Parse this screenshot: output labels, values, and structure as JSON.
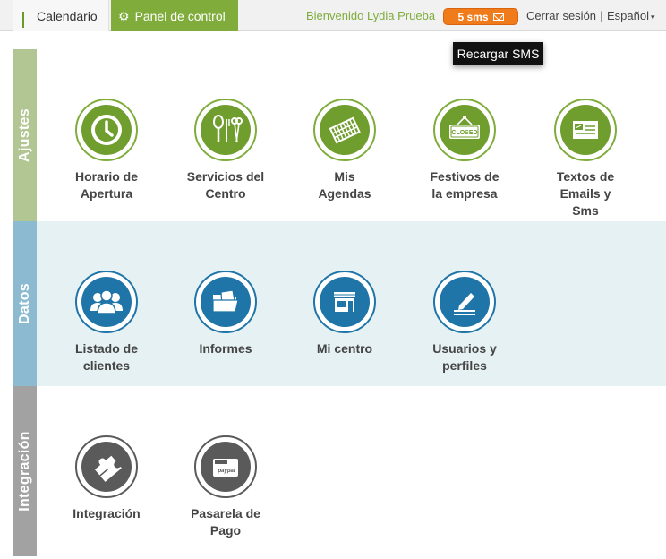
{
  "topbar": {
    "tab_calendar": "Calendario",
    "tab_panel": "Panel de control",
    "welcome": "Bienvenido Lydia Prueba",
    "sms_badge": "5 sms",
    "logout": "Cerrar sesión",
    "separator": "|",
    "language": "Español",
    "language_caret": "▾"
  },
  "tooltip": "Recargar SMS",
  "colors": {
    "accent_green": "#7fac3b",
    "sms_orange": "#f07b1a",
    "datos_blue": "#1f74a8",
    "integration_gray": "#5a5a5a"
  },
  "sections": {
    "ajustes": {
      "label": "Ajustes",
      "items": [
        {
          "line1": "Horario de",
          "line2": "Apertura",
          "line3": "",
          "icon": "clock-icon"
        },
        {
          "line1": "Servicios del",
          "line2": "Centro",
          "line3": "",
          "icon": "tools-icon"
        },
        {
          "line1": "Mis",
          "line2": "Agendas",
          "line3": "",
          "icon": "agenda-icon"
        },
        {
          "line1": "Festivos de",
          "line2": "la empresa",
          "line3": "",
          "icon": "closed-sign-icon",
          "sign_text": "CLOSED"
        },
        {
          "line1": "Textos de",
          "line2": "Emails y",
          "line3": "Sms",
          "icon": "mail-icon"
        }
      ]
    },
    "datos": {
      "label": "Datos",
      "items": [
        {
          "line1": "Listado de",
          "line2": "clientes",
          "icon": "people-icon"
        },
        {
          "line1": "Informes",
          "line2": "",
          "icon": "folder-icon"
        },
        {
          "line1": "Mi centro",
          "line2": "",
          "icon": "store-icon"
        },
        {
          "line1": "Usuarios y",
          "line2": "perfiles",
          "icon": "user-edit-icon"
        }
      ]
    },
    "integracion": {
      "label": "Integración",
      "items": [
        {
          "line1": "Integración",
          "line2": "",
          "icon": "puzzle-icon"
        },
        {
          "line1": "Pasarela de",
          "line2": "Pago",
          "icon": "paypal-card-icon",
          "card_text": "paypal"
        }
      ]
    }
  }
}
